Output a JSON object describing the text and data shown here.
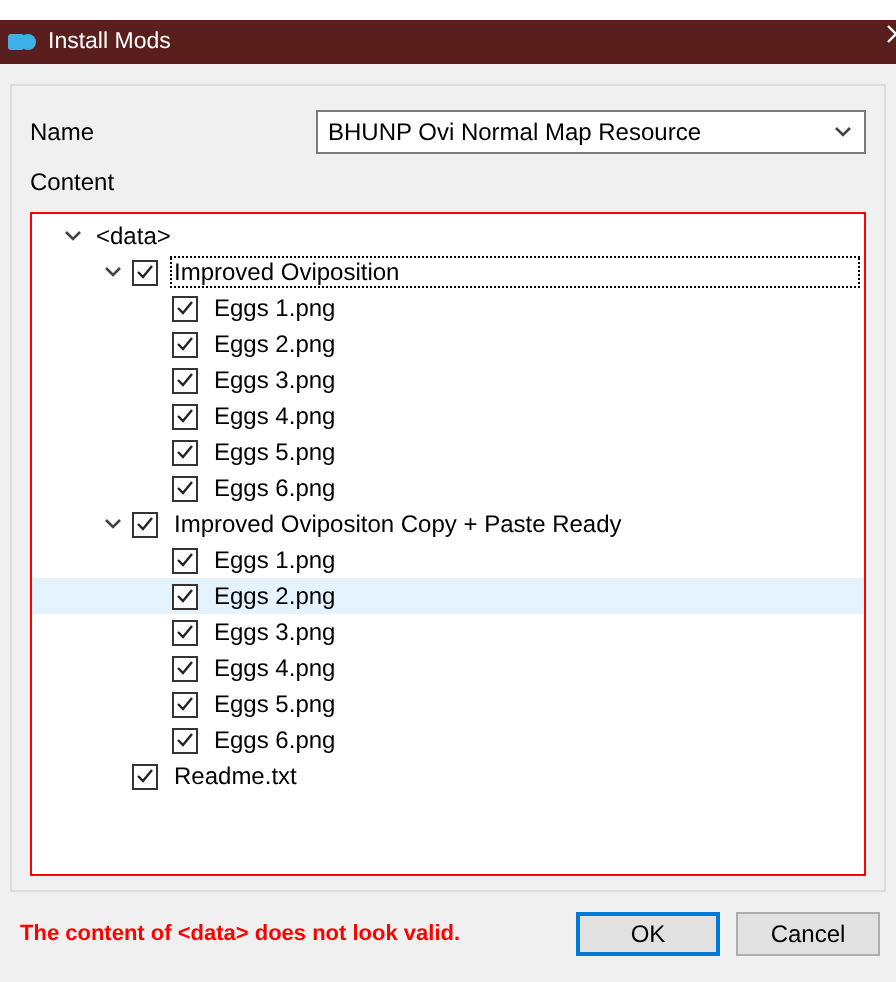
{
  "window": {
    "title": "Install Mods"
  },
  "name_field": {
    "label": "Name",
    "value": "BHUNP Ovi Normal Map Resource"
  },
  "content": {
    "label": "Content",
    "tree": {
      "label": "<data>",
      "expanded": true,
      "children": [
        {
          "label": "Improved Oviposition",
          "checked": true,
          "expanded": true,
          "selected": false,
          "focused": true,
          "children": [
            {
              "label": "Eggs 1.png",
              "checked": true,
              "selected": false,
              "focused": false
            },
            {
              "label": "Eggs 2.png",
              "checked": true,
              "selected": false,
              "focused": false
            },
            {
              "label": "Eggs 3.png",
              "checked": true,
              "selected": false,
              "focused": false
            },
            {
              "label": "Eggs 4.png",
              "checked": true,
              "selected": false,
              "focused": false
            },
            {
              "label": "Eggs 5.png",
              "checked": true,
              "selected": false,
              "focused": false
            },
            {
              "label": "Eggs 6.png",
              "checked": true,
              "selected": false,
              "focused": false
            }
          ]
        },
        {
          "label": "Improved Ovipositon Copy + Paste Ready",
          "checked": true,
          "expanded": true,
          "selected": false,
          "focused": false,
          "children": [
            {
              "label": "Eggs 1.png",
              "checked": true,
              "selected": false,
              "focused": false
            },
            {
              "label": "Eggs 2.png",
              "checked": true,
              "selected": true,
              "focused": false
            },
            {
              "label": "Eggs 3.png",
              "checked": true,
              "selected": false,
              "focused": false
            },
            {
              "label": "Eggs 4.png",
              "checked": true,
              "selected": false,
              "focused": false
            },
            {
              "label": "Eggs 5.png",
              "checked": true,
              "selected": false,
              "focused": false
            },
            {
              "label": "Eggs 6.png",
              "checked": true,
              "selected": false,
              "focused": false
            }
          ]
        },
        {
          "label": "Readme.txt",
          "checked": true,
          "selected": false,
          "focused": false
        }
      ]
    }
  },
  "error": "The content of <data> does not look valid.",
  "buttons": [
    {
      "label": "OK",
      "default": true
    },
    {
      "label": "Cancel",
      "default": false
    }
  ]
}
